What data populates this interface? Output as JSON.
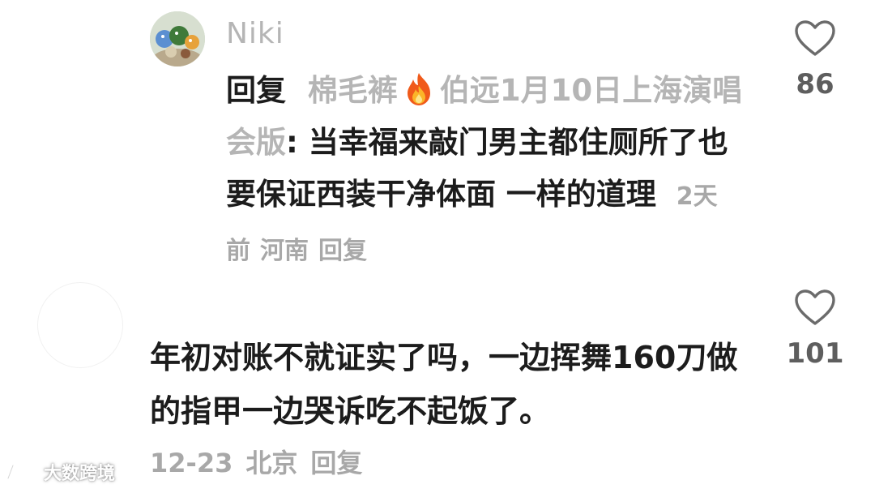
{
  "reply": {
    "username": "Niki",
    "reply_prefix": "回复",
    "reply_to_name_part1": "棉毛裤",
    "reply_to_name_part2": "伯远1月10日上海演唱会版",
    "colon": ":",
    "text": "当幸福来敲门男主都住厕所了也要保证西装干净体面 一样的道理",
    "time": "2天前",
    "location": "河南",
    "reply_action": "回复",
    "likes": "86"
  },
  "comment": {
    "text": "年初对账不就证实了吗，一边挥舞160刀做的指甲一边哭诉吃不起饭了。",
    "date": "12-23",
    "location": "北京",
    "reply_action": "回复",
    "likes": "101"
  },
  "watermark": {
    "text": "大数跨境"
  },
  "icons": {
    "like": "heart-outline-icon",
    "fire": "fire-emoji-icon"
  },
  "colors": {
    "text_primary": "#1c1c1c",
    "text_muted": "#b5b5b5",
    "meta": "#a8a8a8",
    "like_count": "#5e5e5e"
  }
}
